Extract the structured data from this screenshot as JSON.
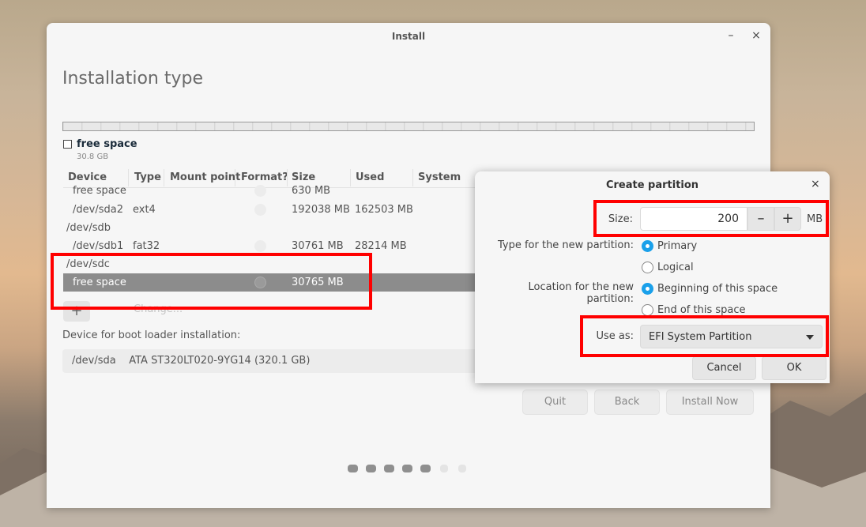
{
  "window": {
    "title": "Install",
    "minimize": "–",
    "close": "×"
  },
  "page": {
    "heading": "Installation type"
  },
  "partition_bar": {
    "label": "free space",
    "size": "30.8 GB"
  },
  "table": {
    "headers": [
      "Device",
      "Type",
      "Mount point",
      "Format?",
      "Size",
      "Used",
      "System"
    ],
    "rows": [
      {
        "device": "free space",
        "type": "",
        "mount": "",
        "size": "630 MB",
        "used": ""
      },
      {
        "device": "/dev/sda2",
        "type": "ext4",
        "mount": "",
        "size": "192038 MB",
        "used": "162503 MB"
      },
      {
        "device": "/dev/sdb",
        "type": "",
        "mount": "",
        "size": "",
        "used": ""
      },
      {
        "device": "/dev/sdb1",
        "type": "fat32",
        "mount": "",
        "size": "30761 MB",
        "used": "28214 MB"
      },
      {
        "device": "/dev/sdc",
        "type": "",
        "mount": "",
        "size": "",
        "used": ""
      },
      {
        "device": "free space",
        "type": "",
        "mount": "",
        "size": "30765 MB",
        "used": "",
        "selected": true
      }
    ]
  },
  "toolbar": {
    "add": "+",
    "remove": "–",
    "change": "Change..."
  },
  "boot_loader": {
    "label": "Device for boot loader installation:",
    "device": "/dev/sda",
    "model": "ATA ST320LT020-9YG14 (320.1 GB)"
  },
  "buttons": {
    "quit": "Quit",
    "back": "Back",
    "install_now": "Install Now"
  },
  "progress_dots": {
    "total": 7,
    "done": 5
  },
  "dialog": {
    "title": "Create partition",
    "close": "×",
    "size_label": "Size:",
    "size_value": "200",
    "size_minus": "–",
    "size_plus": "+",
    "size_unit": "MB",
    "type_label": "Type for the new partition:",
    "type_options": [
      "Primary",
      "Logical"
    ],
    "type_selected": "Primary",
    "location_label": "Location for the new partition:",
    "location_options": [
      "Beginning of this space",
      "End of this space"
    ],
    "location_selected": "Beginning of this space",
    "use_as_label": "Use as:",
    "use_as_value": "EFI System Partition",
    "cancel": "Cancel",
    "ok": "OK"
  },
  "colors": {
    "highlight": "#ff0000",
    "radio_selected": "#1aa0ea",
    "selected_row": "#8c8c8c"
  }
}
